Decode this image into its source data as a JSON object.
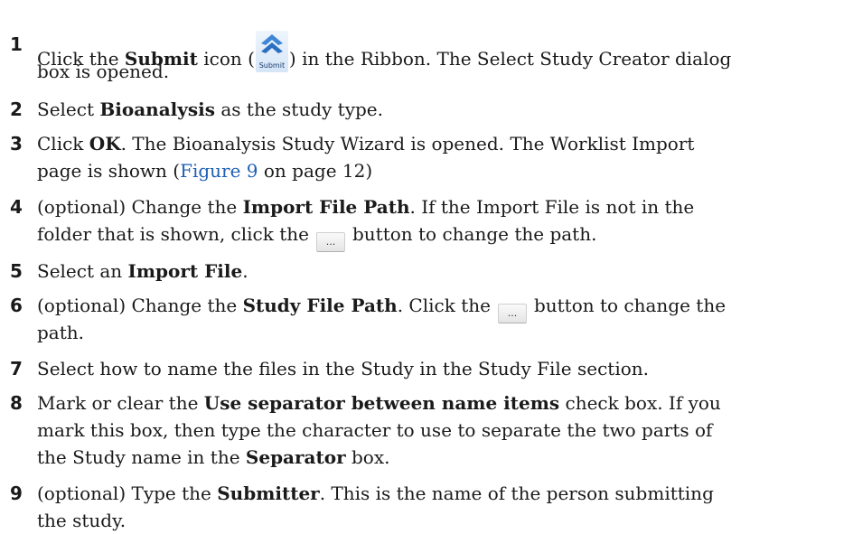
{
  "icons": {
    "submit_caption": "Submit",
    "browse_label": "..."
  },
  "steps": [
    {
      "num": "1",
      "l1_a": "Click the ",
      "l1_b": "Submit",
      "l1_c": " icon (",
      "l1_d": ") in the Ribbon. The Select Study Creator dialog",
      "l2": "box is opened."
    },
    {
      "num": "2",
      "a": "Select ",
      "b": "Bioanalysis",
      "c": " as the study type."
    },
    {
      "num": "3",
      "l1_a": "Click ",
      "l1_b": "OK",
      "l1_c": ". The Bioanalysis Study Wizard is opened. The Worklist Import",
      "l2_a": "page is shown (",
      "l2_link": "Figure 9",
      "l2_b": " on page 12)"
    },
    {
      "num": "4",
      "l1_a": "(optional) Change the ",
      "l1_b": "Import File Path",
      "l1_c": ". If the Import File is not in the",
      "l2_a": "folder that is shown, click the",
      "l2_b": "button to change the path."
    },
    {
      "num": "5",
      "a": "Select an ",
      "b": "Import File",
      "c": "."
    },
    {
      "num": "6",
      "l1_a": "(optional) Change the ",
      "l1_b": "Study File Path",
      "l1_c": ". Click the",
      "l1_d": "button to change the",
      "l2": "path."
    },
    {
      "num": "7",
      "a": "Select how to name the files in the Study in the Study File section."
    },
    {
      "num": "8",
      "l1_a": "Mark or clear the ",
      "l1_b": "Use separator between name items",
      "l1_c": " check box. If you",
      "l2": "mark this box, then type the character to use to separate the two parts of",
      "l3_a": "the Study name in the ",
      "l3_b": "Separator",
      "l3_c": " box."
    },
    {
      "num": "9",
      "l1_a": "(optional) Type the ",
      "l1_b": "Submitter",
      "l1_c": ". This is the name of the person submitting",
      "l2": "the study."
    }
  ]
}
